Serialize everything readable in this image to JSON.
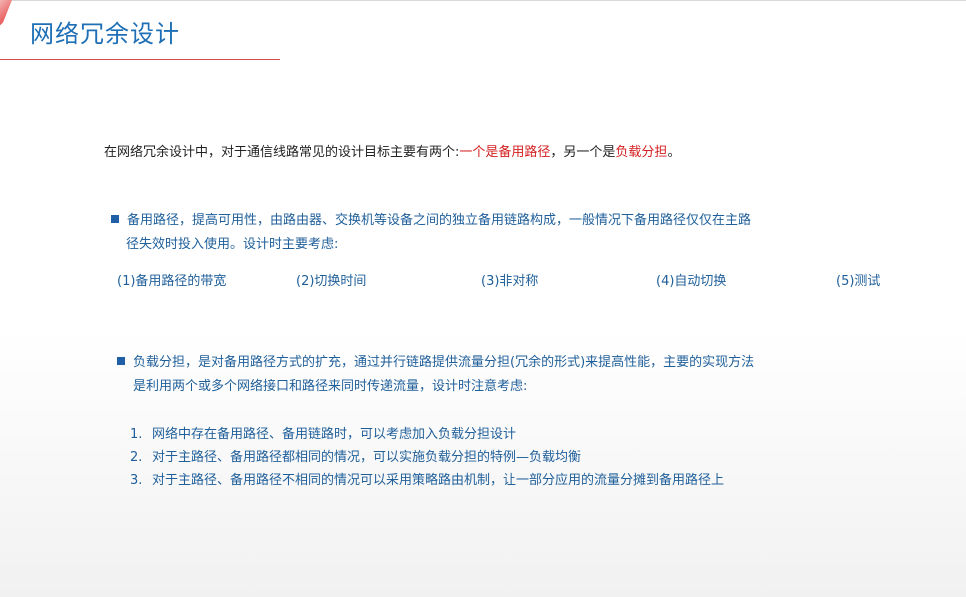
{
  "title": "网络冗余设计",
  "intro": {
    "prefix": "在网络冗余设计中，对于通信线路常见的设计目标主要有两个:",
    "goal1": "一个是备用路径",
    "middle": "，另一个是",
    "goal2": "负载分担",
    "suffix": "。"
  },
  "bullet1": {
    "line1": "备用路径，提高可用性，由路由器、交换机等设备之间的独立备用链路构成，一般情况下备用路径仅仅在主路",
    "line2": "径失效时投入使用。设计时主要考虑:"
  },
  "factors": [
    "(1)备用路径的带宽",
    "(2)切换时间",
    "(3)非对称",
    "(4)自动切换",
    "(5)测试"
  ],
  "bullet2": {
    "line1": "负载分担，是对备用路径方式的扩充，通过并行链路提供流量分担(冗余的形式)来提高性能，主要的实现方法",
    "line2": "是利用两个或多个网络接口和路径来同时传递流量，设计时注意考虑:"
  },
  "steps": [
    {
      "num": "1.",
      "text": "网络中存在备用路径、备用链路时，可以考虑加入负载分担设计"
    },
    {
      "num": "2.",
      "text": "对于主路径、备用路径都相同的情况，可以实施负载分担的特例—负载均衡"
    },
    {
      "num": "3.",
      "text": "对于主路径、备用路径不相同的情况可以采用策略路由机制，让一部分应用的流量分摊到备用路径上"
    }
  ],
  "colors": {
    "title": "#1e6fb5",
    "highlight": "#d42020",
    "body_blue": "#1f5f9a",
    "accent_line": "#d84a4a"
  }
}
